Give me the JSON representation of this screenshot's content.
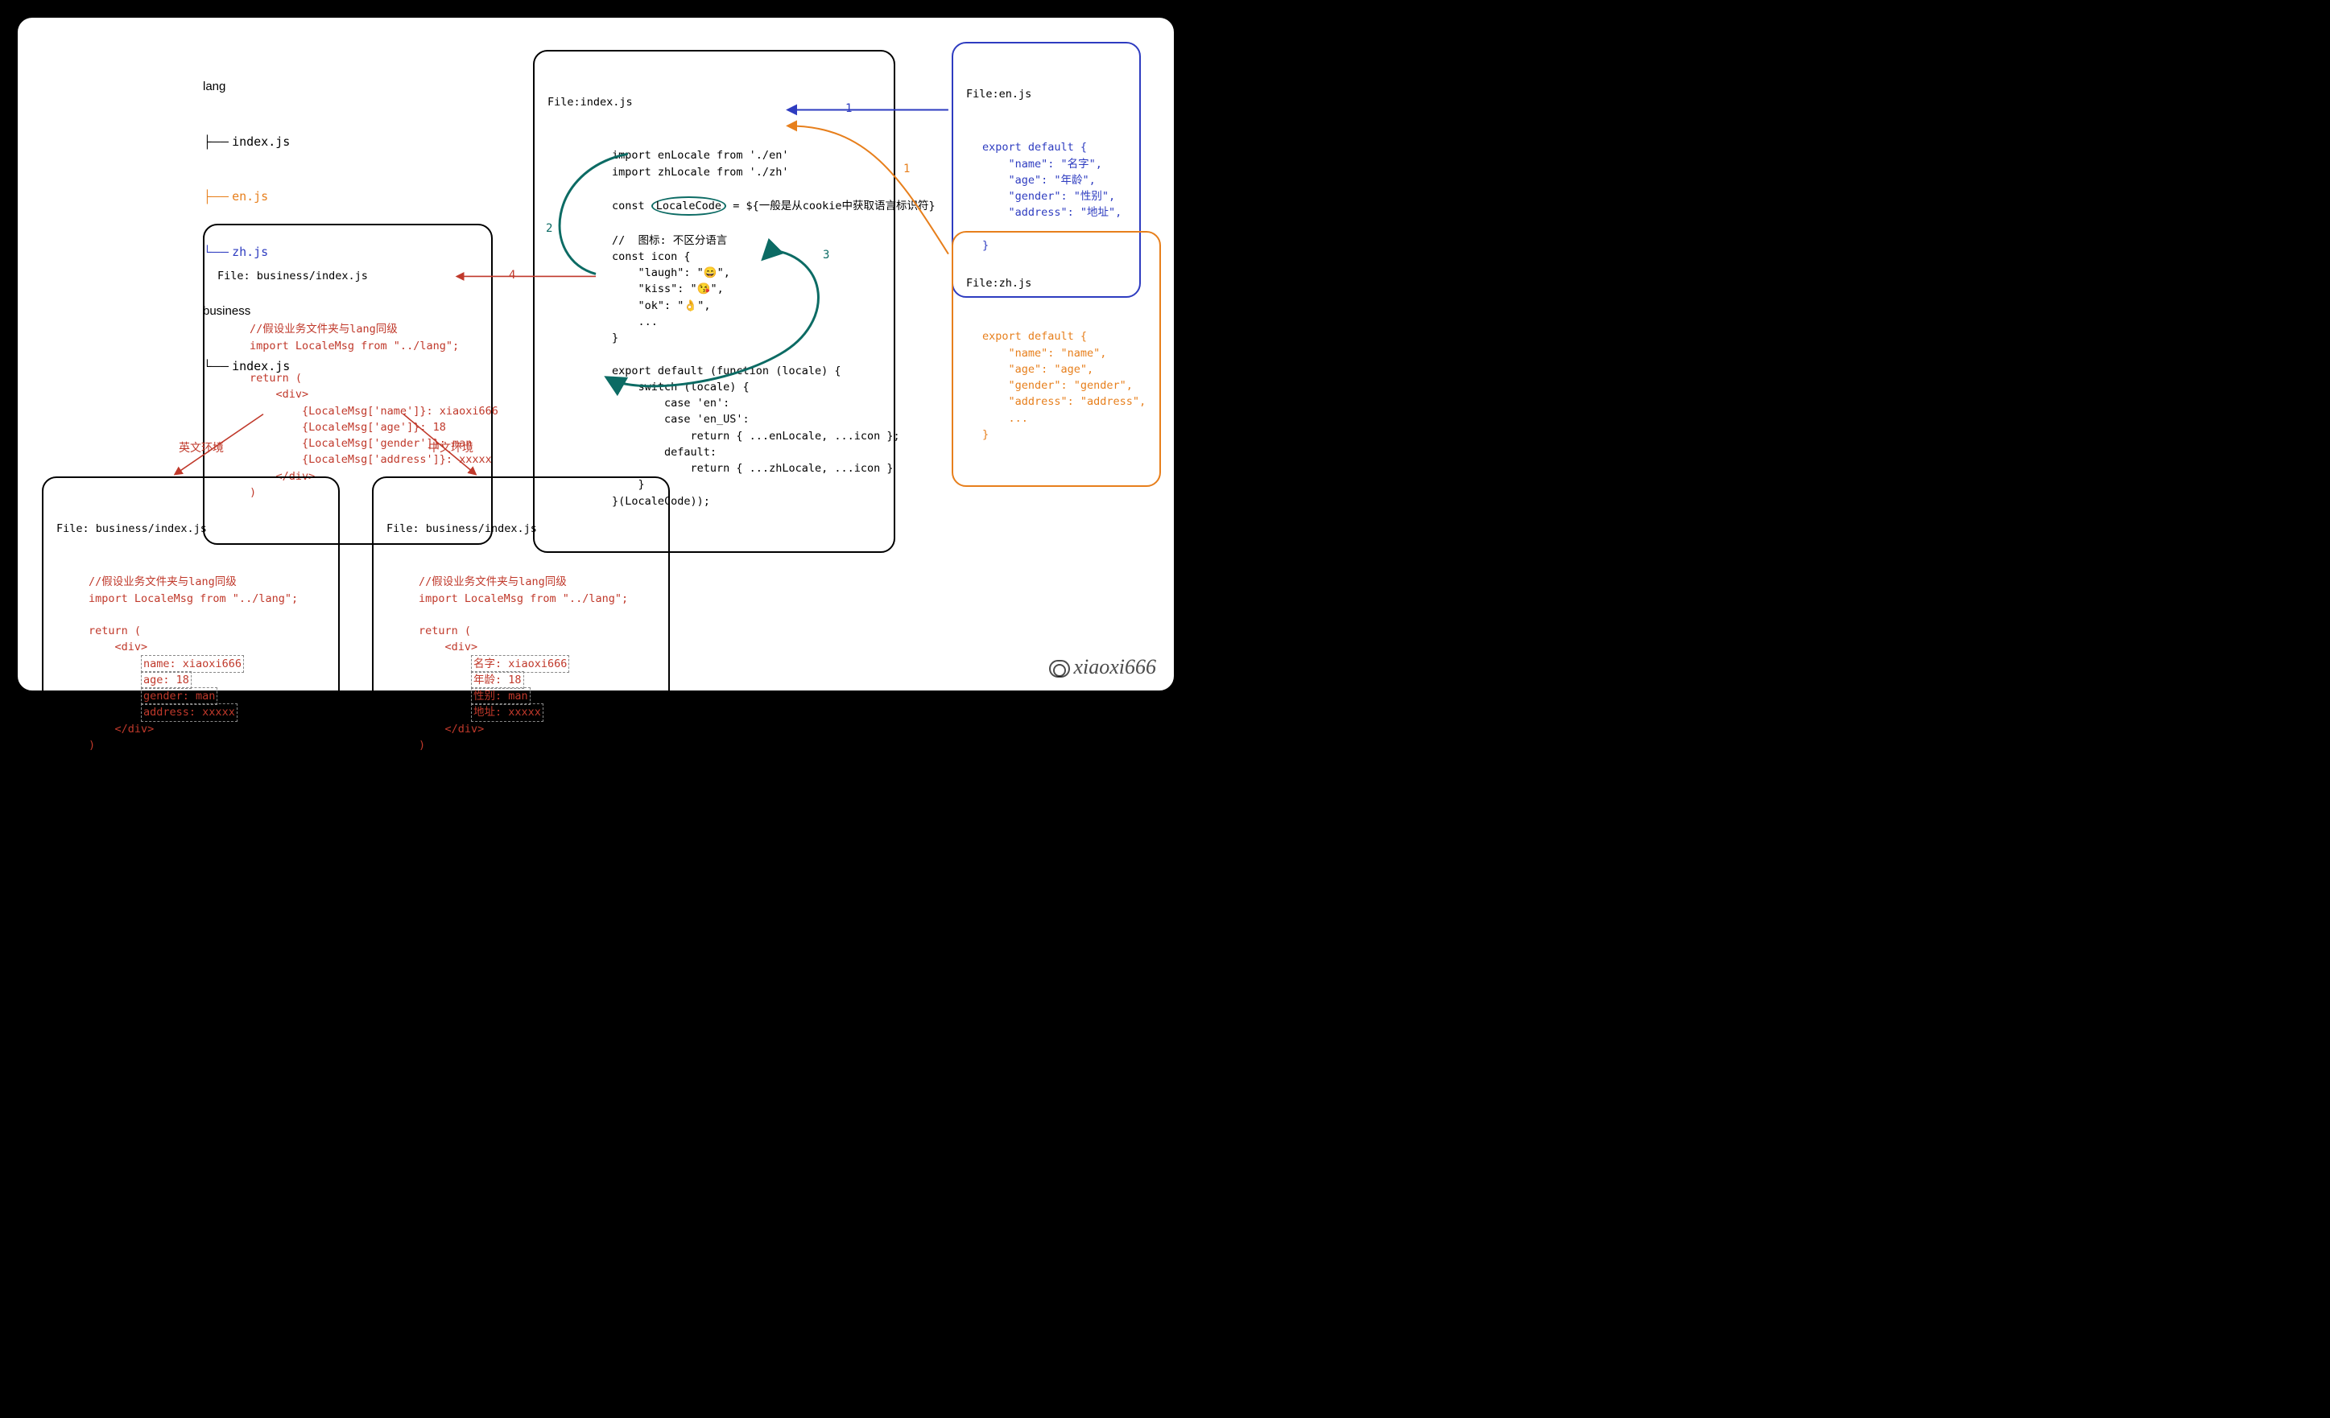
{
  "tree": {
    "lang": "lang",
    "index": "index.js",
    "en": "en.js",
    "zh": "zh.js",
    "business": "business",
    "biz_index": "index.js"
  },
  "box_index": {
    "title": "File:index.js",
    "l1": "import enLocale from './en'",
    "l2": "import zhLocale from './zh'",
    "l3a": "const ",
    "l3b": "LocaleCode",
    "l3c": " = ${一般是从cookie中获取语言标识符}",
    "l4": "//  图标: 不区分语言",
    "l5": "const icon {",
    "l6": "    \"laugh\": \"😄\",",
    "l7": "    \"kiss\": \"😘\",",
    "l8": "    \"ok\": \"👌\",",
    "l9": "    ...",
    "l10": "}",
    "l11": "export default (function (locale) {",
    "l12": "    switch (locale) {",
    "l13": "        case 'en':",
    "l14": "        case 'en_US':",
    "l15": "            return { ...enLocale, ...icon };",
    "l16": "        default:",
    "l17": "            return { ...zhLocale, ...icon }",
    "l18": "    }",
    "l19": "}(LocaleCode));"
  },
  "box_en": {
    "title": "File:en.js",
    "l1": "export default {",
    "l2": "    \"name\": \"名字\",",
    "l3": "    \"age\": \"年龄\",",
    "l4": "    \"gender\": \"性别\",",
    "l5": "    \"address\": \"地址\",",
    "l6": "    ...",
    "l7": "}"
  },
  "box_zh": {
    "title": "File:zh.js",
    "l1": "export default {",
    "l2": "    \"name\": \"name\",",
    "l3": "    \"age\": \"age\",",
    "l4": "    \"gender\": \"gender\",",
    "l5": "    \"address\": \"address\",",
    "l6": "    ...",
    "l7": "}"
  },
  "box_biz": {
    "title": "File: business/index.js",
    "l1": "//假设业务文件夹与lang同级",
    "l2": "import LocaleMsg from \"../lang\";",
    "l3": "return (",
    "l4": "    <div>",
    "l5": "        {LocaleMsg['name']}: xiaoxi666",
    "l6": "        {LocaleMsg['age']}: 18",
    "l7": "        {LocaleMsg['gender']}: man",
    "l8": "        {LocaleMsg['address']}: xxxxx",
    "l9": "    </div>",
    "l10": ")"
  },
  "box_out_en": {
    "title": "File: business/index.js",
    "l1": "//假设业务文件夹与lang同级",
    "l2": "import LocaleMsg from \"../lang\";",
    "l3": "return (",
    "l4a": "    <div>",
    "l5": "name: xiaoxi666",
    "l6": "age: 18",
    "l7": "gender: man",
    "l8": "address: xxxxx",
    "l9a": "    </div>",
    "l10": ")"
  },
  "box_out_zh": {
    "title": "File: business/index.js",
    "l1": "//假设业务文件夹与lang同级",
    "l2": "import LocaleMsg from \"../lang\";",
    "l3": "return (",
    "l4a": "    <div>",
    "l5": "名字: xiaoxi666",
    "l6": "年龄: 18",
    "l7": "性别: man",
    "l8": "地址: xxxxx",
    "l9a": "    </div>",
    "l10": ")"
  },
  "labels": {
    "n1": "1",
    "n1b": "1",
    "n2": "2",
    "n3": "3",
    "n4": "4",
    "en_env": "英文环境",
    "zh_env": "中文环境"
  },
  "watermark": "xiaoxi666"
}
